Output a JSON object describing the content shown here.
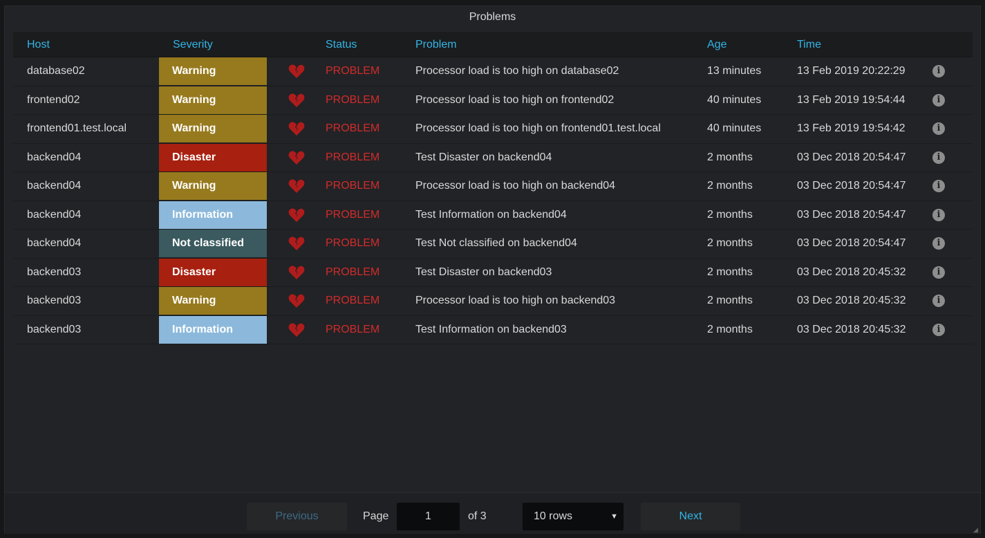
{
  "panel": {
    "title": "Problems"
  },
  "table": {
    "headers": {
      "host": "Host",
      "severity": "Severity",
      "status": "Status",
      "problem": "Problem",
      "age": "Age",
      "time": "Time"
    },
    "rows": [
      {
        "host": "database02",
        "severity": "Warning",
        "severity_color": "#977a1d",
        "status": "PROBLEM",
        "problem": "Processor load is too high on database02",
        "age": "13 minutes",
        "time": "13 Feb 2019 20:22:29"
      },
      {
        "host": "frontend02",
        "severity": "Warning",
        "severity_color": "#977a1d",
        "status": "PROBLEM",
        "problem": "Processor load is too high on frontend02",
        "age": "40 minutes",
        "time": "13 Feb 2019 19:54:44"
      },
      {
        "host": "frontend01.test.local",
        "severity": "Warning",
        "severity_color": "#977a1d",
        "status": "PROBLEM",
        "problem": "Processor load is too high on frontend01.test.local",
        "age": "40 minutes",
        "time": "13 Feb 2019 19:54:42"
      },
      {
        "host": "backend04",
        "severity": "Disaster",
        "severity_color": "#a8200f",
        "status": "PROBLEM",
        "problem": "Test Disaster on backend04",
        "age": "2 months",
        "time": "03 Dec 2018 20:54:47"
      },
      {
        "host": "backend04",
        "severity": "Warning",
        "severity_color": "#977a1d",
        "status": "PROBLEM",
        "problem": "Processor load is too high on backend04",
        "age": "2 months",
        "time": "03 Dec 2018 20:54:47"
      },
      {
        "host": "backend04",
        "severity": "Information",
        "severity_color": "#8cb9db",
        "status": "PROBLEM",
        "problem": "Test Information on backend04",
        "age": "2 months",
        "time": "03 Dec 2018 20:54:47"
      },
      {
        "host": "backend04",
        "severity": "Not classified",
        "severity_color": "#3a5a5f",
        "status": "PROBLEM",
        "problem": "Test Not classified on backend04",
        "age": "2 months",
        "time": "03 Dec 2018 20:54:47"
      },
      {
        "host": "backend03",
        "severity": "Disaster",
        "severity_color": "#a8200f",
        "status": "PROBLEM",
        "problem": "Test Disaster on backend03",
        "age": "2 months",
        "time": "03 Dec 2018 20:45:32"
      },
      {
        "host": "backend03",
        "severity": "Warning",
        "severity_color": "#977a1d",
        "status": "PROBLEM",
        "problem": "Processor load is too high on backend03",
        "age": "2 months",
        "time": "03 Dec 2018 20:45:32"
      },
      {
        "host": "backend03",
        "severity": "Information",
        "severity_color": "#8cb9db",
        "status": "PROBLEM",
        "problem": "Test Information on backend03",
        "age": "2 months",
        "time": "03 Dec 2018 20:45:32"
      }
    ],
    "status_icon": "broken-heart-icon",
    "info_icon": "info-icon"
  },
  "pagination": {
    "previous_label": "Previous",
    "page_label": "Page",
    "page_value": "1",
    "of_label": "of 3",
    "rows_selected": "10 rows",
    "next_label": "Next"
  },
  "colors": {
    "header_text": "#33b5e5",
    "problem_text": "#d32b2b",
    "panel_bg": "#222326"
  }
}
